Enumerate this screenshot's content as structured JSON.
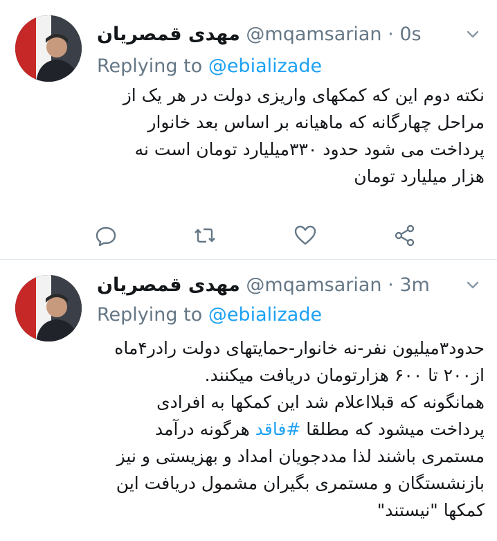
{
  "tweets": [
    {
      "display_name": "مهدی قمصریان",
      "handle": "@mqamsarian",
      "separator": "·",
      "time": "0s",
      "replying_label": "Replying to",
      "replying_to": "@ebializade",
      "lines": [
        "نکته دوم این که کمکهای واریزی دولت در هر یک از",
        "مراحل چهارگانه که ماهیانه بر اساس بعد خانوار",
        "پرداخت می شود حدود ۳۳۰میلیارد تومان است نه",
        "هزار میلیارد تومان"
      ],
      "icons": [
        "reply-icon",
        "retweet-icon",
        "like-icon",
        "share-icon"
      ]
    },
    {
      "display_name": "مهدی قمصریان",
      "handle": "@mqamsarian",
      "separator": "·",
      "time": "3m",
      "replying_label": "Replying to",
      "replying_to": "@ebializade",
      "lines": [
        "حدود۳میلیون نفر-نه خانوار-حمایتهای دولت رادر۴ماه",
        "از۲۰۰ تا ۶۰۰ هزارتومان دریافت میکنند.",
        "همانگونه که قبلااعلام شد این کمکها به افرادی",
        "هرگونه درآمد",
        "مستمری باشند لذا مددجویان امداد و بهزیستی و نیز",
        "بازنشستگان و مستمری بگیران مشمول دریافت این",
        "کمکها \"نیستند\""
      ],
      "line4_prefix": "پرداخت میشود که مطلقا",
      "hashtag": "#فاقد"
    }
  ],
  "colors": {
    "link": "#1da1f2",
    "muted": "#657786",
    "text": "#14171a",
    "divider": "#e1e8ed"
  }
}
